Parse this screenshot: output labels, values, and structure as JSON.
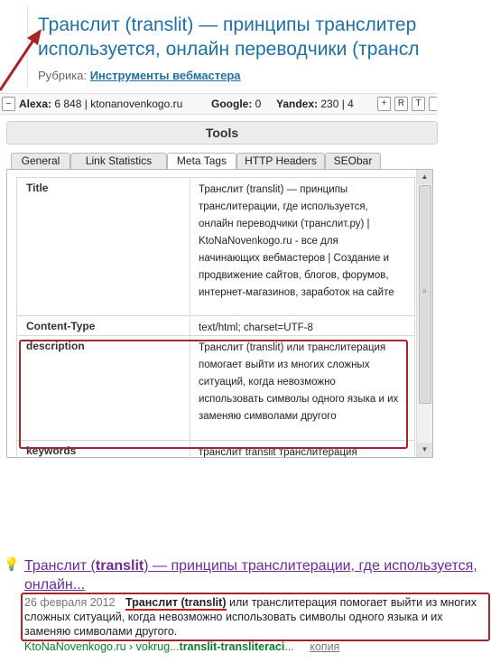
{
  "article": {
    "title_line1": "Транслит (translit) — принципы транслитер",
    "title_line2": "используется, онлайн переводчики (трансл",
    "rubric_label": "Рубрика:",
    "rubric_link": "Инструменты вебмастера"
  },
  "toolbar": {
    "collapse": "–",
    "alexa_label": "Alexa:",
    "alexa_value": "6 848 | ktonanovenkogo.ru",
    "google_label": "Google:",
    "google_value": "0",
    "yandex_label": "Yandex:",
    "yandex_value": "230 | 4",
    "btn_plus": "+",
    "btn_r": "R",
    "btn_t": "T"
  },
  "tools": {
    "title": "Tools",
    "tabs": [
      "General",
      "Link Statistics",
      "Meta Tags",
      "HTTP Headers",
      "SEObar"
    ],
    "active_tab": "Meta Tags",
    "rows": [
      {
        "key": "Title",
        "value": "Транслит (translit) — принципы транслитерации, где используется, онлайн переводчики (транслит.ру) | KtoNaNovenkogo.ru - все для начинающих вебмастеров | Создание и продвижение сайтов, блогов, форумов, интернет-магазинов, заработок на сайте"
      },
      {
        "key": "Content-Type",
        "value": "text/html; charset=UTF-8"
      },
      {
        "key": "description",
        "value": "Транслит (translit) или транслитерация помогает выйти из многих сложных ситуаций, когда невозможно использовать символы одного языка и их заменяю символами другого"
      },
      {
        "key": "keywords",
        "value": "транслит translit транслитерация"
      }
    ]
  },
  "snippet": {
    "title_a": "Транслит (",
    "title_b": "translit",
    "title_c": ") — принципы транслитерации, где используется, онлайн...",
    "date": "26 февраля 2012",
    "body_a": "Транслит (",
    "body_b": "translit",
    "body_c": ")",
    "body_rest": " или транслитерация помогает выйти из многих сложных ситуаций, когда невозможно использовать символы одного языка и их заменяю символами другого.",
    "url_a": "KtoNaNovenkogo.ru › vokrug...",
    "url_b": "translit-transliteraci",
    "url_c": "...",
    "copy_link": "копия"
  },
  "colors": {
    "highlight": "#a3262a",
    "link": "#1f6fa3",
    "visited": "#6b2c91",
    "url_green": "#0e7a28"
  }
}
